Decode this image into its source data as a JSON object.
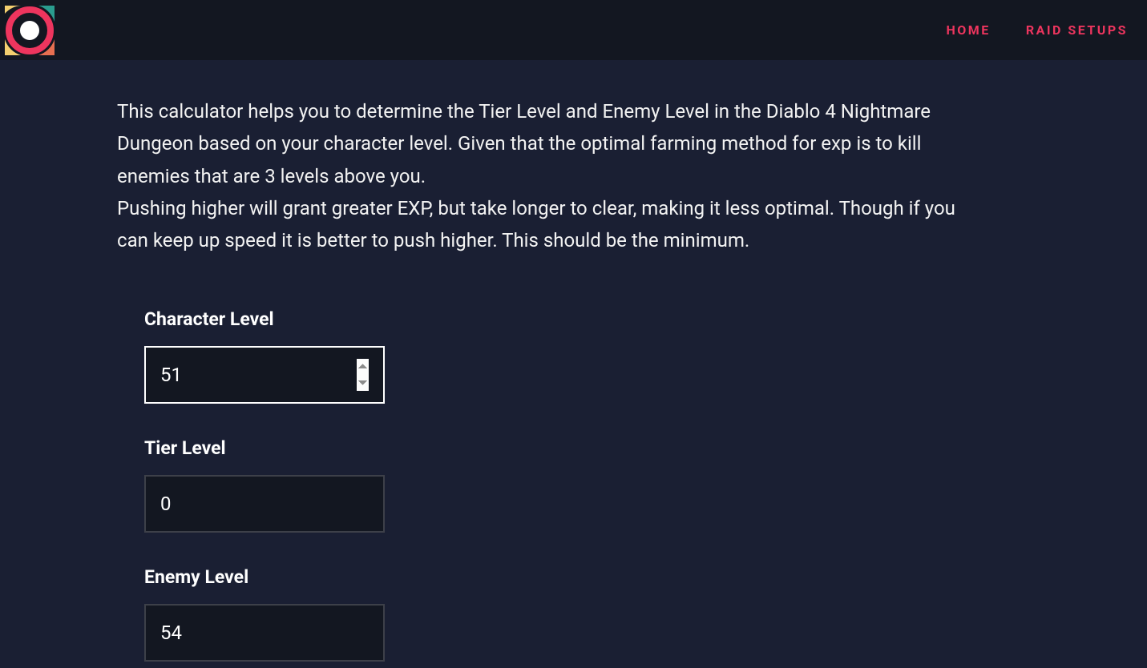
{
  "nav": {
    "home": "HOME",
    "raid_setups": "RAID SETUPS"
  },
  "description": {
    "p1": "This calculator helps you to determine the Tier Level and Enemy Level in the Diablo 4 Nightmare Dungeon based on your character level. Given that the optimal farming method for exp is to kill enemies that are 3 levels above you.",
    "p2": "Pushing higher will grant greater EXP, but take longer to clear, making it less optimal. Though if you can keep up speed it is better to push higher. This should be the minimum."
  },
  "form": {
    "character_level": {
      "label": "Character Level",
      "value": "51"
    },
    "tier_level": {
      "label": "Tier Level",
      "value": "0"
    },
    "enemy_level": {
      "label": "Enemy Level",
      "value": "54"
    }
  }
}
